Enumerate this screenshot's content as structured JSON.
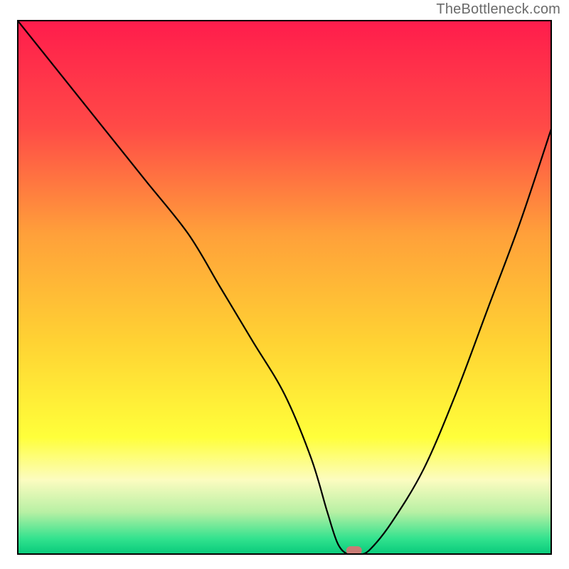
{
  "watermark": "TheBottleneck.com",
  "chart_data": {
    "type": "line",
    "title": "",
    "xlabel": "",
    "ylabel": "",
    "xlim": [
      0,
      100
    ],
    "ylim": [
      0,
      100
    ],
    "grid": false,
    "series": [
      {
        "name": "curve",
        "x": [
          0,
          8,
          16,
          24,
          32,
          38,
          44,
          50,
          55,
          58,
          60,
          62,
          64,
          66,
          70,
          76,
          82,
          88,
          94,
          100
        ],
        "y": [
          100,
          90,
          80,
          70,
          60,
          50,
          40,
          30,
          18,
          8,
          2,
          0,
          0,
          1,
          6,
          16,
          30,
          46,
          62,
          80
        ]
      }
    ],
    "marker": {
      "x": 63,
      "y": 0.8,
      "color": "#c97b75"
    },
    "background_gradient": {
      "stops": [
        {
          "offset": 0.0,
          "color": "#ff1c4c"
        },
        {
          "offset": 0.2,
          "color": "#ff4a47"
        },
        {
          "offset": 0.4,
          "color": "#ffa03a"
        },
        {
          "offset": 0.6,
          "color": "#ffd233"
        },
        {
          "offset": 0.78,
          "color": "#ffff3a"
        },
        {
          "offset": 0.86,
          "color": "#fcfcc0"
        },
        {
          "offset": 0.92,
          "color": "#b8f0a4"
        },
        {
          "offset": 0.97,
          "color": "#32e28e"
        },
        {
          "offset": 1.0,
          "color": "#06c97a"
        }
      ]
    },
    "frame_color": "#000000",
    "frame_width": 4,
    "line_color": "#000000",
    "line_width": 2.2
  }
}
